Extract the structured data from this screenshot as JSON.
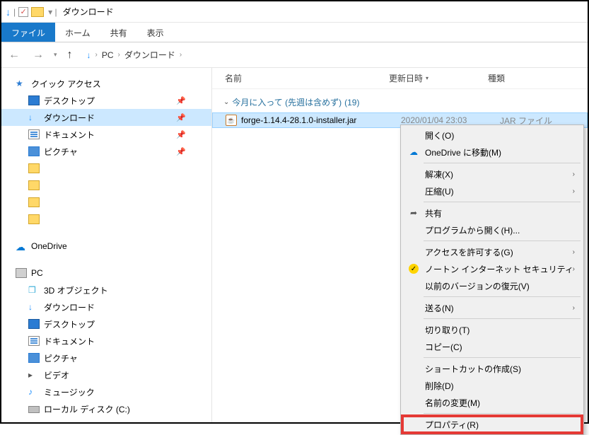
{
  "titlebar": {
    "title": "ダウンロード"
  },
  "tabs": {
    "file": "ファイル",
    "home": "ホーム",
    "share": "共有",
    "view": "表示"
  },
  "address": {
    "pc": "PC",
    "folder": "ダウンロード"
  },
  "sidebar": {
    "quick_access": "クイック アクセス",
    "desktop": "デスクトップ",
    "downloads": "ダウンロード",
    "documents": "ドキュメント",
    "pictures": "ピクチャ",
    "onedrive": "OneDrive",
    "pc": "PC",
    "objects3d": "3D オブジェクト",
    "pc_downloads": "ダウンロード",
    "pc_desktop": "デスクトップ",
    "pc_documents": "ドキュメント",
    "pc_pictures": "ピクチャ",
    "pc_videos": "ビデオ",
    "pc_music": "ミュージック",
    "local_disk": "ローカル ディスク (C:)"
  },
  "columns": {
    "name": "名前",
    "date": "更新日時",
    "type": "種類"
  },
  "group": {
    "title": "今月に入って (先週は含めず)",
    "count": "(19)"
  },
  "file": {
    "name": "forge-1.14.4-28.1.0-installer.jar",
    "date": "2020/01/04 23:03",
    "type": "JAR ファイル"
  },
  "ctx": {
    "open": "開く(O)",
    "onedrive": "OneDrive に移動(M)",
    "extract": "解凍(X)",
    "compress": "圧縮(U)",
    "share": "共有",
    "open_with": "プログラムから開く(H)...",
    "grant_access": "アクセスを許可する(G)",
    "norton": "ノートン インターネット セキュリティ",
    "prev_versions": "以前のバージョンの復元(V)",
    "send_to": "送る(N)",
    "cut": "切り取り(T)",
    "copy": "コピー(C)",
    "shortcut": "ショートカットの作成(S)",
    "delete": "削除(D)",
    "rename": "名前の変更(M)",
    "properties": "プロパティ(R)"
  }
}
